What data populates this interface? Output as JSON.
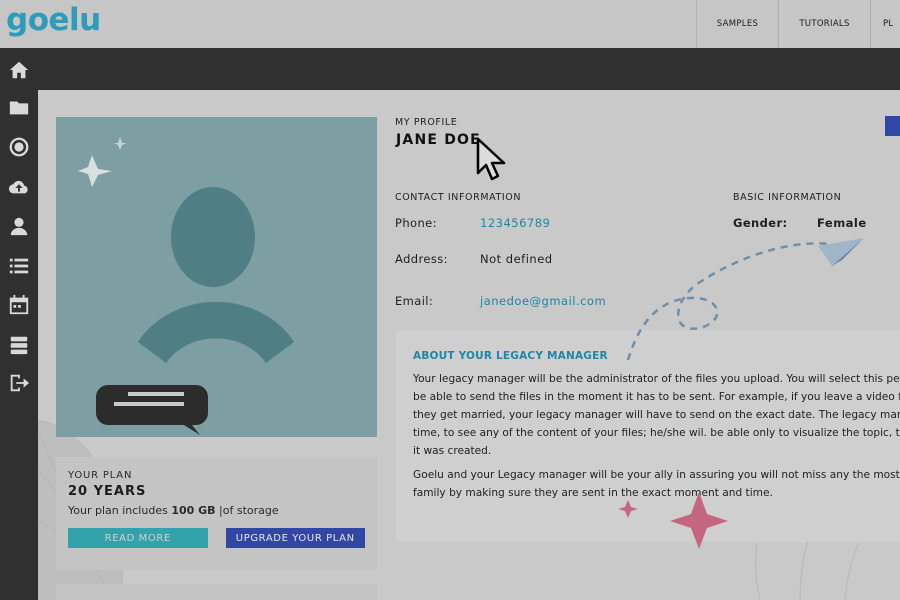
{
  "header": {
    "logo": "goelu",
    "nav": [
      {
        "label": "SAMPLES"
      },
      {
        "label": "TUTORIALS"
      },
      {
        "label": "PL"
      }
    ]
  },
  "sidebar": {
    "items": [
      {
        "icon": "home-icon"
      },
      {
        "icon": "folder-icon"
      },
      {
        "icon": "record-icon"
      },
      {
        "icon": "cloud-upload-icon"
      },
      {
        "icon": "user-icon"
      },
      {
        "icon": "list-icon"
      },
      {
        "icon": "calendar-icon"
      },
      {
        "icon": "storage-icon"
      },
      {
        "icon": "logout-icon"
      }
    ]
  },
  "plan": {
    "label": "YOUR PLAN",
    "term": "20 YEARS",
    "desc_prefix": "Your plan includes ",
    "storage": "100 GB",
    "desc_suffix": " |of storage",
    "read_more": "READ MORE",
    "upgrade": "UPGRADE YOUR PLAN"
  },
  "profile": {
    "label": "MY PROFILE",
    "name": "JANE DOE",
    "contact_label": "CONTACT INFORMATION",
    "basic_label": "BASIC INFORMATION",
    "phone_label": "Phone:",
    "phone": "123456789",
    "address_label": "Address:",
    "address": "Not defined",
    "email_label": "Email:",
    "email": "janedoe@gmail.com",
    "gender_label": "Gender:",
    "gender": "Female"
  },
  "legacy": {
    "title": "ABOUT YOUR LEGACY MANAGER",
    "lines": [
      "Your legacy manager will be the administrator of the files you upload. You will select this pers",
      "be able to send the files in the moment it has to be sent. For example, if you leave a video for",
      "they get married, your legacy manager will have to send on the exact date. The legacy manag",
      "time, to see any of the content of your files; he/she wil. be able only to visualize the topic, title",
      "it was created."
    ],
    "lines2": [
      "Goelu and your Legacy manager will be your ally in assuring you will not miss any the most",
      "family by making sure they are sent in the exact moment and time."
    ]
  },
  "colors": {
    "brand": "#2e9bbb",
    "link": "#1f86a6",
    "upgrade": "#3247a5",
    "read_more": "#33a3ab",
    "avatar_bg": "#7d9ea3"
  }
}
